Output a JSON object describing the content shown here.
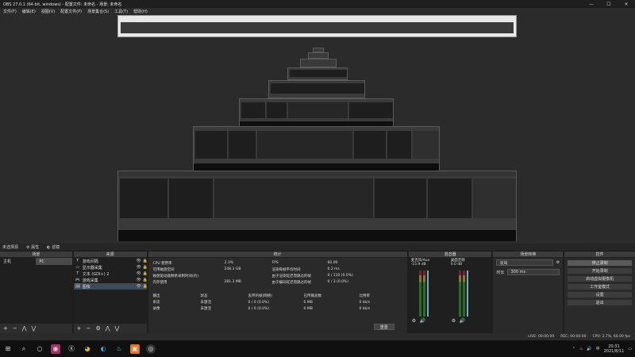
{
  "window": {
    "title": "OBS 27.0.1 (64-bit, windows) - 配置文件: 未命名 - 场景: 未命名",
    "min": "—",
    "max": "☐",
    "close": "✕"
  },
  "menu": [
    "文件(F)",
    "编辑(E)",
    "视图(V)",
    "配置文件(P)",
    "场景集合(S)",
    "工具(T)",
    "帮助(H)"
  ],
  "preview_bar": {
    "label": "未选择源",
    "properties": "属性",
    "filters": "滤镜"
  },
  "scenes": {
    "title": "场景",
    "items": [
      "主机",
      "PC"
    ],
    "selected": 1
  },
  "sources": {
    "title": "来源",
    "items": [
      {
        "icon": "T",
        "name": "游戏间隔"
      },
      {
        "icon": "▭",
        "name": "显示器采集"
      },
      {
        "icon": "T",
        "name": "文本 (GDI+) 2"
      },
      {
        "icon": "🎮",
        "name": "游戏采集"
      },
      {
        "icon": "🖼",
        "name": "图像"
      }
    ],
    "selected": 4
  },
  "stats": {
    "title": "统计",
    "rows": [
      [
        "CPU 使用率",
        "2.3%",
        "",
        "FPS",
        "60.00",
        ""
      ],
      [
        "可用磁盘空间",
        "248.3 GB",
        "",
        "渲染每帧平均时间",
        "0.2 ms",
        ""
      ],
      [
        "磁盘驱动器剩余录制时间(约)",
        "",
        "",
        "由于渲染延迟而跳过的帧",
        "0 / 110 (0.0%)",
        ""
      ],
      [
        "内存使用",
        "281.3 MB",
        "",
        "由于编码延迟而跳过的帧",
        "0 / 3 (0.0%)",
        ""
      ]
    ],
    "out_headers": [
      "输出",
      "状态",
      "丢弃的帧(网络)",
      "已传输总数",
      "比特率"
    ],
    "out_rows": [
      [
        "串流",
        "未激活",
        "0 / 0 (0.0%)",
        "0 MB",
        "0 kb/s"
      ],
      [
        "录像",
        "未激活",
        "0 / 0 (0.0%)",
        "0 MB",
        "0 kb/s"
      ]
    ],
    "reset": "重置"
  },
  "mixer": {
    "title": "混音器",
    "channels": [
      {
        "name": "麦克风/Aux",
        "db": "-15.9 dB"
      },
      {
        "name": "桌面音频",
        "db": "0.0 dB"
      }
    ]
  },
  "transitions": {
    "title": "场景转换",
    "type": "淡出",
    "duration_label": "时长",
    "duration": "300 ms"
  },
  "controls": {
    "title": "控件",
    "buttons": [
      "停止录制",
      "开始录制",
      "启动虚拟摄像机",
      "工作室模式",
      "设置",
      "退出"
    ]
  },
  "status": {
    "live": "LIVE: 00:00:00",
    "rec": "REC: 00:00:00",
    "cpu": "CPU: 2.7%, 60.00 fps"
  },
  "taskbar": {
    "time": "20:31",
    "date": "2021/8/11"
  }
}
